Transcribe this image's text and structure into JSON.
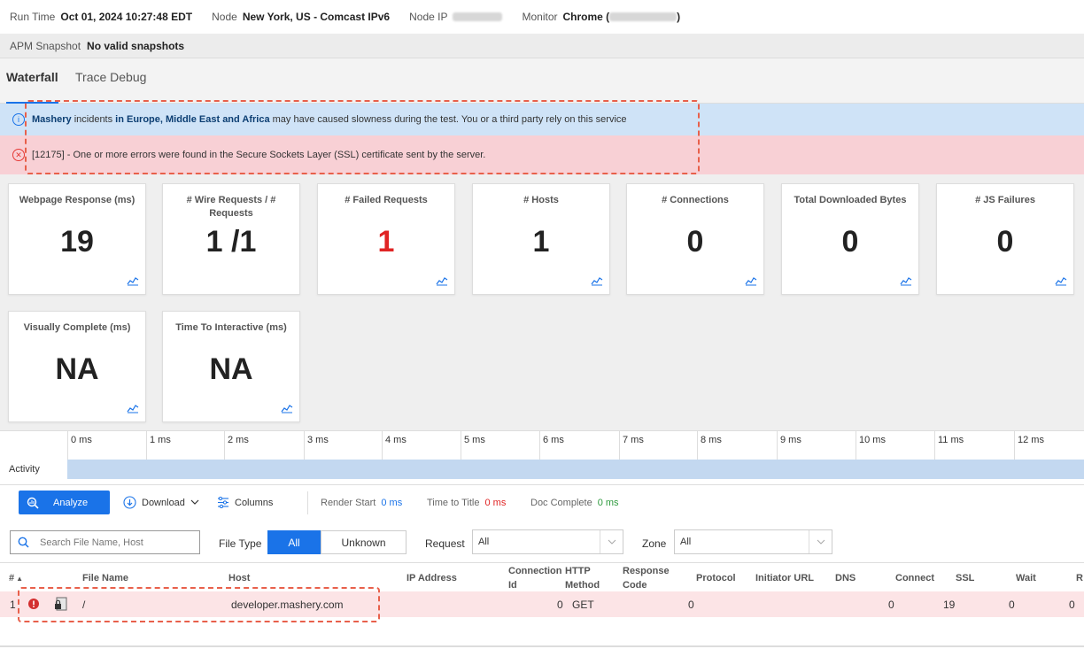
{
  "meta": {
    "run_time_label": "Run Time",
    "run_time_value": "Oct 01, 2024 10:27:48 EDT",
    "node_label": "Node",
    "node_value": "New York, US - Comcast IPv6",
    "node_ip_label": "Node IP",
    "monitor_label": "Monitor",
    "monitor_value_prefix": "Chrome (",
    "monitor_value_suffix": ")",
    "apm_label": "APM Snapshot",
    "apm_value": "No valid snapshots"
  },
  "tabs": [
    {
      "label": "Waterfall",
      "active": true
    },
    {
      "label": "Trace Debug",
      "active": false
    }
  ],
  "alerts": {
    "info_icon": "info-icon",
    "info_bold1": "Mashery",
    "info_text1": " incidents ",
    "info_bold2": "in Europe, Middle East and Africa",
    "info_text2": " may have caused slowness during the test. You or a third party rely on this service",
    "error_icon": "error-x-icon",
    "error_text": "[12175] - One or more errors were found in the Secure Sockets Layer (SSL) certificate sent by the server."
  },
  "metrics": [
    {
      "title": "Webpage Response (ms)",
      "value": "19"
    },
    {
      "title": "# Wire Requests / # Requests",
      "value": "1 /1"
    },
    {
      "title": "# Failed Requests",
      "value": "1",
      "highlight": true
    },
    {
      "title": "# Hosts",
      "value": "1"
    },
    {
      "title": "# Connections",
      "value": "0"
    },
    {
      "title": "Total Downloaded Bytes",
      "value": "0"
    },
    {
      "title": "# JS Failures",
      "value": "0"
    },
    {
      "title": "Visually Complete (ms)",
      "value": "NA"
    },
    {
      "title": "Time To Interactive (ms)",
      "value": "NA"
    }
  ],
  "timeline": {
    "ticks": [
      "0 ms",
      "1 ms",
      "2 ms",
      "3 ms",
      "4 ms",
      "5 ms",
      "6 ms",
      "7 ms",
      "8 ms",
      "9 ms",
      "10 ms",
      "11 ms",
      "12 ms"
    ],
    "activity_label": "Activity"
  },
  "toolbar": {
    "analyze_label": "Analyze",
    "download_label": "Download",
    "columns_label": "Columns",
    "render_start_label": "Render Start",
    "render_start_value": "0 ms",
    "time_to_title_label": "Time to Title",
    "time_to_title_value": "0 ms",
    "doc_complete_label": "Doc Complete",
    "doc_complete_value": "0 ms"
  },
  "filters": {
    "search_placeholder": "Search File Name, Host",
    "file_type_label": "File Type",
    "file_type_all": "All",
    "file_type_unknown": "Unknown",
    "request_label": "Request",
    "request_value": "All",
    "zone_label": "Zone",
    "zone_value": "All"
  },
  "table": {
    "headers": {
      "num": "#",
      "file_name": "File Name",
      "host": "Host",
      "ip": "IP Address",
      "conn_id": "Connection Id",
      "http_method": "HTTP Method",
      "response_code": "Response Code",
      "protocol": "Protocol",
      "initiator": "Initiator URL",
      "dns": "DNS",
      "connect": "Connect",
      "ssl": "SSL",
      "wait": "Wait",
      "r": "R"
    },
    "rows": [
      {
        "num": "1",
        "file_name": "/",
        "host": "developer.mashery.com",
        "conn_id": "0",
        "method": "GET",
        "response_code": "0",
        "connect": "0",
        "ssl": "19",
        "wait": "0",
        "r": "0"
      }
    ]
  },
  "colors": {
    "accent": "#1a73e8",
    "info_bg": "#cfe3f7",
    "error_bg": "#f8d0d5",
    "failed_red": "#e02424",
    "highlight_dash": "#e8604b"
  }
}
